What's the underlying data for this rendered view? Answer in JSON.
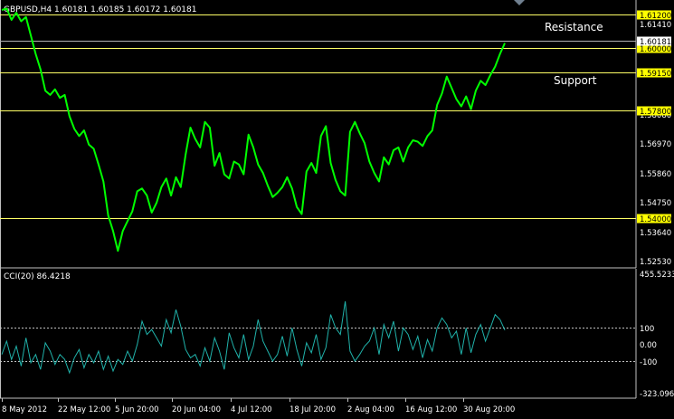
{
  "colors": {
    "background": "#000000",
    "price_line": "#00ff00",
    "cci_line": "#20b2aa",
    "level_line": "#ffff66",
    "level_label_bg": "#ffff00",
    "axis_text": "#ffffff",
    "frame": "#c0c0c0",
    "marker": "#708090"
  },
  "chart_data": [
    {
      "type": "line",
      "title": "GBPUSD,H4  1.60181 1.60185 1.60172 1.60181",
      "ylim": [
        1.5225,
        1.617
      ],
      "y_ticks": [
        "1.61410",
        "1.58080",
        "1.56970",
        "1.55860",
        "1.54750",
        "1.53640",
        "1.52530"
      ],
      "grid": false,
      "current_price": "1.60181",
      "levels": [
        {
          "value": 1.612,
          "label": "1.61200"
        },
        {
          "value": 1.6,
          "label": "1.60000"
        },
        {
          "value": 1.5915,
          "label": "1.59150"
        },
        {
          "value": 1.578,
          "label": "1.57800"
        },
        {
          "value": 1.54,
          "label": "1.54000"
        }
      ],
      "annotations": [
        "Resistance",
        "Support"
      ],
      "series": [
        {
          "values": [
            1.6135,
            1.614,
            1.61,
            1.6125,
            1.6095,
            1.611,
            1.6045,
            1.598,
            1.5925,
            1.585,
            1.5835,
            1.5855,
            1.5825,
            1.5835,
            1.576,
            1.5715,
            1.569,
            1.571,
            1.566,
            1.5645,
            1.559,
            1.553,
            1.541,
            1.5355,
            1.5285,
            1.5355,
            1.539,
            1.5425,
            1.5495,
            1.5505,
            1.548,
            1.542,
            1.5455,
            1.551,
            1.554,
            1.548,
            1.5545,
            1.551,
            1.5625,
            1.572,
            1.568,
            1.565,
            1.574,
            1.572,
            1.5585,
            1.563,
            1.5555,
            1.554,
            1.56,
            1.559,
            1.5555,
            1.5695,
            1.565,
            1.559,
            1.556,
            1.5515,
            1.5475,
            1.549,
            1.551,
            1.5545,
            1.5505,
            1.544,
            1.5415,
            1.5565,
            1.5595,
            1.556,
            1.569,
            1.5725,
            1.5595,
            1.5535,
            1.5495,
            1.548,
            1.5705,
            1.574,
            1.57,
            1.5665,
            1.56,
            1.556,
            1.553,
            1.5615,
            1.559,
            1.564,
            1.565,
            1.56,
            1.565,
            1.5675,
            1.567,
            1.5655,
            1.569,
            1.571,
            1.58,
            1.584,
            1.59,
            1.586,
            1.582,
            1.5795,
            1.583,
            1.5785,
            1.585,
            1.5885,
            1.587,
            1.5905,
            1.5935,
            1.598,
            1.6018
          ]
        }
      ]
    },
    {
      "type": "line",
      "title": "CCI(20) 86.4218",
      "ylim": [
        -323.096,
        455.5233
      ],
      "y_ticks": [
        "455.5233",
        "100",
        "0.00",
        "-100",
        "-323.096"
      ],
      "grid": false,
      "levels": [
        {
          "value": 100,
          "label": "100"
        },
        {
          "value": -100,
          "label": "-100"
        }
      ],
      "series": [
        {
          "values": [
            -60,
            20,
            -90,
            -10,
            -130,
            40,
            -110,
            -60,
            -150,
            10,
            -40,
            -120,
            -60,
            -90,
            -170,
            -80,
            -30,
            -140,
            -60,
            -110,
            -40,
            -150,
            -70,
            -160,
            -90,
            -120,
            -40,
            -100,
            0,
            140,
            60,
            90,
            40,
            -10,
            150,
            70,
            210,
            110,
            -30,
            -80,
            -60,
            -130,
            -20,
            -100,
            40,
            -40,
            -150,
            70,
            -20,
            -80,
            60,
            -90,
            -10,
            150,
            20,
            -40,
            -100,
            -60,
            50,
            -70,
            100,
            -30,
            -130,
            10,
            -50,
            60,
            -90,
            -20,
            180,
            100,
            60,
            260,
            -40,
            -100,
            -60,
            -10,
            20,
            100,
            -60,
            120,
            40,
            140,
            -40,
            100,
            60,
            -30,
            50,
            -80,
            30,
            -40,
            100,
            160,
            120,
            40,
            80,
            -60,
            100,
            -50,
            60,
            120,
            20,
            100,
            180,
            150,
            86.4218
          ]
        }
      ]
    }
  ],
  "x_axis": {
    "labels": [
      "8 May 2012",
      "22 May 12:00",
      "5 Jun 20:00",
      "20 Jun 04:00",
      "4 Jul 12:00",
      "18 Jul 20:00",
      "2 Aug 04:00",
      "16 Aug 12:00",
      "30 Aug 20:00"
    ]
  }
}
